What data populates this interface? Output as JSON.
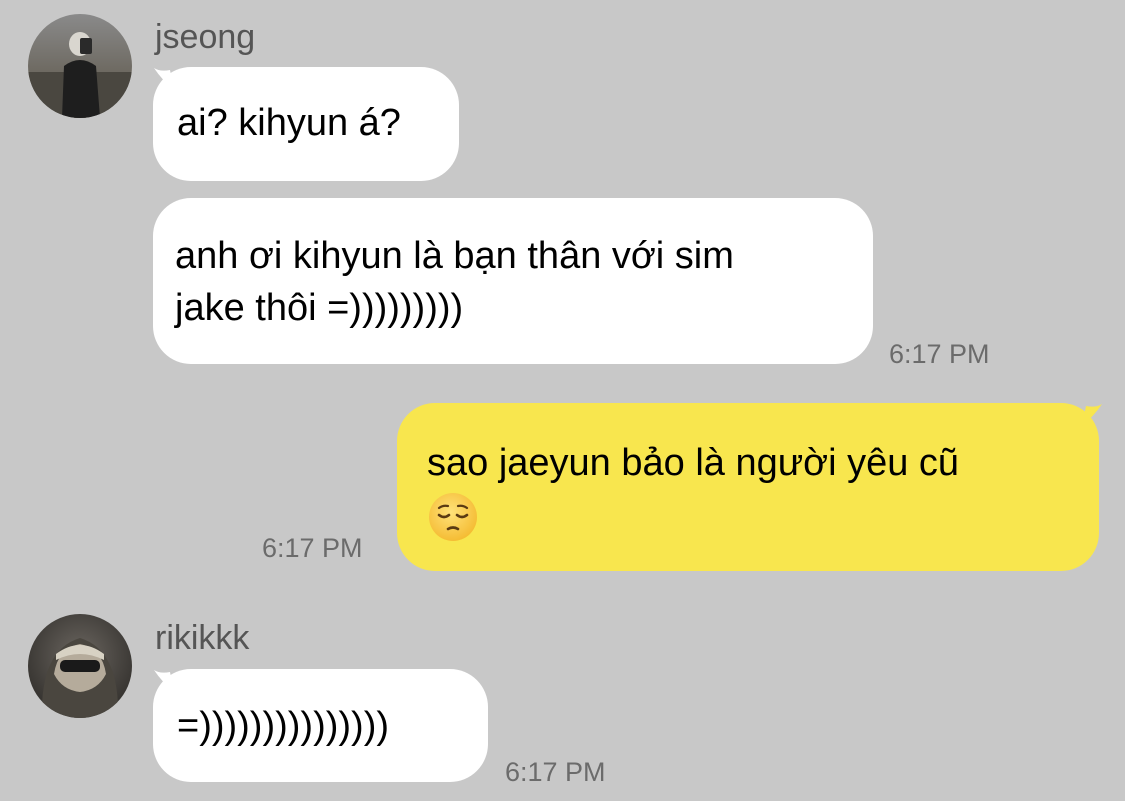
{
  "messages": [
    {
      "sender": "jseong",
      "avatar_icon": "user-avatar-icon",
      "bubbles": [
        {
          "text": "ai? kihyun á?"
        },
        {
          "text_lines": [
            "anh ơi kihyun là bạn thân với sim",
            "jake thôi =)))))))))"
          ],
          "time": "6:17 PM"
        }
      ]
    },
    {
      "sender": "me",
      "bubbles": [
        {
          "text": "sao jaeyun bảo là người yêu cũ",
          "emoji": "pensive-face-icon",
          "time": "6:17 PM"
        }
      ]
    },
    {
      "sender": "rikikkk",
      "avatar_icon": "user-avatar-icon",
      "bubbles": [
        {
          "text": "=)))))))))))))))",
          "time": "6:17 PM"
        }
      ]
    }
  ],
  "colors": {
    "background": "#c8c8c8",
    "incoming_bubble": "#ffffff",
    "outgoing_bubble": "#f8e64e",
    "timestamp": "#6b6b6b",
    "sender_name": "#555555"
  }
}
